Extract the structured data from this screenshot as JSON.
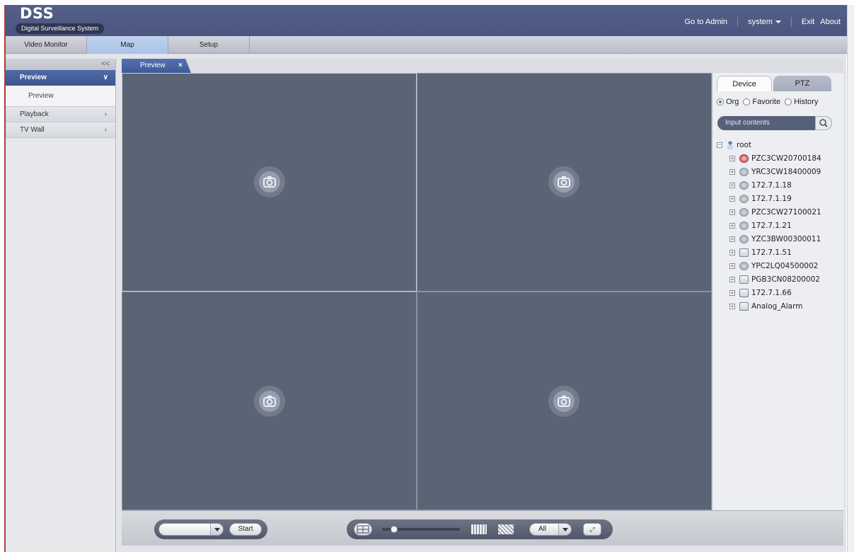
{
  "header": {
    "title": "DSS",
    "subtitle": "Digital Surveillance System",
    "go_to_admin": "Go to Admin",
    "user_menu": "system",
    "exit": "Exit",
    "about": "About"
  },
  "nav": {
    "tabs": [
      {
        "label": "Video Monitor"
      },
      {
        "label": "Map"
      },
      {
        "label": "Setup"
      }
    ]
  },
  "sidebar": {
    "collapse": "<<",
    "section": "Preview",
    "sub_item": "Preview",
    "items": [
      {
        "label": "Playback"
      },
      {
        "label": "TV Wall"
      }
    ]
  },
  "content": {
    "tab_label": "Preview",
    "tab_close": "×"
  },
  "right_panel": {
    "tabs": [
      "Device",
      "PTZ"
    ],
    "radios": [
      {
        "label": "Org",
        "checked": true
      },
      {
        "label": "Favorite",
        "checked": false
      },
      {
        "label": "History",
        "checked": false
      }
    ],
    "search_placeholder": "Input contents",
    "tree_root": "root",
    "tree_items": [
      {
        "label": "PZC3CW20700184",
        "icon": "camera-alert-icon"
      },
      {
        "label": "YRC3CW18400009",
        "icon": "camera-icon"
      },
      {
        "label": "172.7.1.18",
        "icon": "camera-icon"
      },
      {
        "label": "172.7.1.19",
        "icon": "camera-icon"
      },
      {
        "label": "PZC3CW27100021",
        "icon": "camera-icon"
      },
      {
        "label": "172.7.1.21",
        "icon": "camera-icon"
      },
      {
        "label": "YZC3BW00300011",
        "icon": "camera-icon"
      },
      {
        "label": "172.7.1.51",
        "icon": "nvr-icon"
      },
      {
        "label": "YPC2LQ04500002",
        "icon": "camera-icon"
      },
      {
        "label": "PGB3CN08200002",
        "icon": "nvr-icon"
      },
      {
        "label": "172.7.1.66",
        "icon": "nvr-icon"
      },
      {
        "label": "Analog_Alarm",
        "icon": "nvr-icon"
      }
    ]
  },
  "toolbar": {
    "start_label": "Start",
    "all_label": "All"
  }
}
